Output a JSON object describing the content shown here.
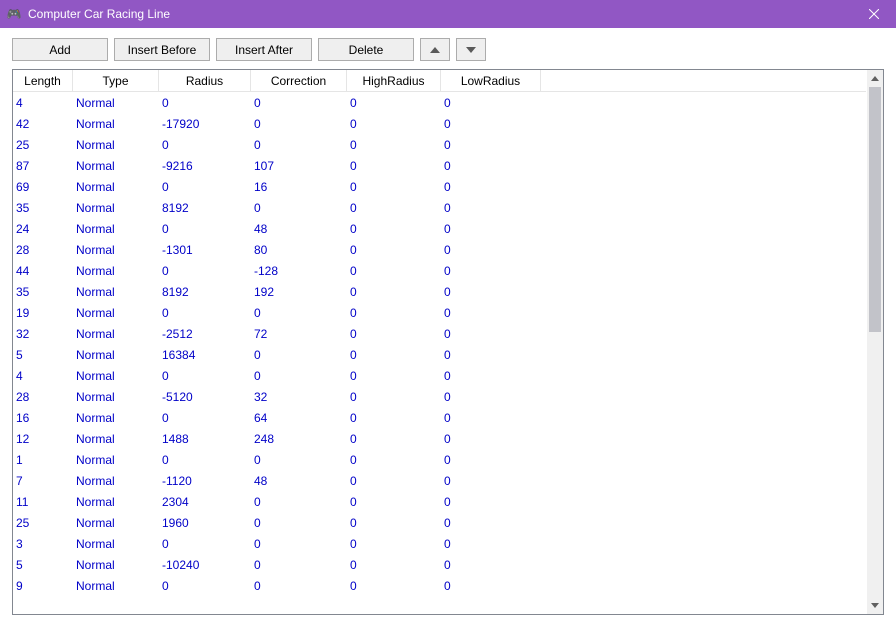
{
  "window": {
    "title": "Computer Car Racing Line"
  },
  "toolbar": {
    "add": "Add",
    "insertBefore": "Insert Before",
    "insertAfter": "Insert After",
    "delete": "Delete"
  },
  "columns": {
    "length": "Length",
    "type": "Type",
    "radius": "Radius",
    "correction": "Correction",
    "highRadius": "HighRadius",
    "lowRadius": "LowRadius"
  },
  "rows": [
    {
      "length": "4",
      "type": "Normal",
      "radius": "0",
      "correction": "0",
      "highRadius": "0",
      "lowRadius": "0"
    },
    {
      "length": "42",
      "type": "Normal",
      "radius": "-17920",
      "correction": "0",
      "highRadius": "0",
      "lowRadius": "0"
    },
    {
      "length": "25",
      "type": "Normal",
      "radius": "0",
      "correction": "0",
      "highRadius": "0",
      "lowRadius": "0"
    },
    {
      "length": "87",
      "type": "Normal",
      "radius": "-9216",
      "correction": "107",
      "highRadius": "0",
      "lowRadius": "0"
    },
    {
      "length": "69",
      "type": "Normal",
      "radius": "0",
      "correction": "16",
      "highRadius": "0",
      "lowRadius": "0"
    },
    {
      "length": "35",
      "type": "Normal",
      "radius": "8192",
      "correction": "0",
      "highRadius": "0",
      "lowRadius": "0"
    },
    {
      "length": "24",
      "type": "Normal",
      "radius": "0",
      "correction": "48",
      "highRadius": "0",
      "lowRadius": "0"
    },
    {
      "length": "28",
      "type": "Normal",
      "radius": "-1301",
      "correction": "80",
      "highRadius": "0",
      "lowRadius": "0"
    },
    {
      "length": "44",
      "type": "Normal",
      "radius": "0",
      "correction": "-128",
      "highRadius": "0",
      "lowRadius": "0"
    },
    {
      "length": "35",
      "type": "Normal",
      "radius": "8192",
      "correction": "192",
      "highRadius": "0",
      "lowRadius": "0"
    },
    {
      "length": "19",
      "type": "Normal",
      "radius": "0",
      "correction": "0",
      "highRadius": "0",
      "lowRadius": "0"
    },
    {
      "length": "32",
      "type": "Normal",
      "radius": "-2512",
      "correction": "72",
      "highRadius": "0",
      "lowRadius": "0"
    },
    {
      "length": "5",
      "type": "Normal",
      "radius": "16384",
      "correction": "0",
      "highRadius": "0",
      "lowRadius": "0"
    },
    {
      "length": "4",
      "type": "Normal",
      "radius": "0",
      "correction": "0",
      "highRadius": "0",
      "lowRadius": "0"
    },
    {
      "length": "28",
      "type": "Normal",
      "radius": "-5120",
      "correction": "32",
      "highRadius": "0",
      "lowRadius": "0"
    },
    {
      "length": "16",
      "type": "Normal",
      "radius": "0",
      "correction": "64",
      "highRadius": "0",
      "lowRadius": "0"
    },
    {
      "length": "12",
      "type": "Normal",
      "radius": "1488",
      "correction": "248",
      "highRadius": "0",
      "lowRadius": "0"
    },
    {
      "length": "1",
      "type": "Normal",
      "radius": "0",
      "correction": "0",
      "highRadius": "0",
      "lowRadius": "0"
    },
    {
      "length": "7",
      "type": "Normal",
      "radius": "-1120",
      "correction": "48",
      "highRadius": "0",
      "lowRadius": "0"
    },
    {
      "length": "11",
      "type": "Normal",
      "radius": "2304",
      "correction": "0",
      "highRadius": "0",
      "lowRadius": "0"
    },
    {
      "length": "25",
      "type": "Normal",
      "radius": "1960",
      "correction": "0",
      "highRadius": "0",
      "lowRadius": "0"
    },
    {
      "length": "3",
      "type": "Normal",
      "radius": "0",
      "correction": "0",
      "highRadius": "0",
      "lowRadius": "0"
    },
    {
      "length": "5",
      "type": "Normal",
      "radius": "-10240",
      "correction": "0",
      "highRadius": "0",
      "lowRadius": "0"
    },
    {
      "length": "9",
      "type": "Normal",
      "radius": "0",
      "correction": "0",
      "highRadius": "0",
      "lowRadius": "0"
    }
  ]
}
